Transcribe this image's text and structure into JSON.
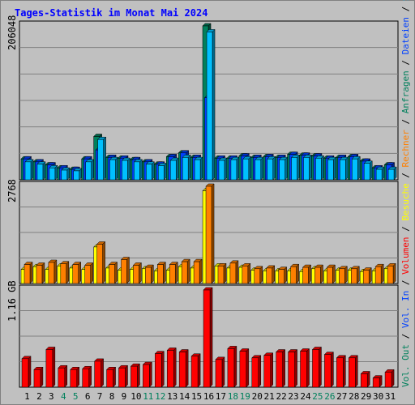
{
  "title": {
    "text": "Tages-Statistik im Monat Mai 2024",
    "color": "#0000ff"
  },
  "colors": {
    "hits": "#00805c",
    "files": "#0040ff",
    "pages": "#00c0ff",
    "visits": "#ffff00",
    "sites": "#ff8000",
    "kbytes": "#ff0000",
    "kbytes_in": "#0040ff",
    "kbytes_out": "#00805c",
    "plot_bg": "#c0c0c0",
    "grid": "#808080",
    "weekend_day": "#00805c",
    "weekday": "#000000"
  },
  "panels": {
    "top": {
      "ymax_label": "206048"
    },
    "middle": {
      "ymax_label": "2768"
    },
    "bottom": {
      "ymax_label": "1.16 GB"
    }
  },
  "legend": {
    "top": [
      {
        "text": "Anfragen",
        "color": "#00805c"
      },
      {
        "text": "Dateien",
        "color": "#0040ff"
      },
      {
        "text": "Seiten",
        "color": "#00c0ff"
      }
    ],
    "middle": [
      {
        "text": "Besuche",
        "color": "#ffff00"
      },
      {
        "text": "Rechner",
        "color": "#ff8000"
      }
    ],
    "bottom": [
      {
        "text": "Vol. Out",
        "color": "#00805c"
      },
      {
        "text": "Vol. In",
        "color": "#0040ff"
      },
      {
        "text": "Volumen",
        "color": "#ff0000"
      }
    ],
    "separator": " / "
  },
  "chart_data": {
    "type": "bar",
    "days": [
      "1",
      "2",
      "3",
      "4",
      "5",
      "6",
      "7",
      "8",
      "9",
      "10",
      "11",
      "12",
      "13",
      "14",
      "15",
      "16",
      "17",
      "18",
      "19",
      "20",
      "21",
      "22",
      "23",
      "24",
      "25",
      "26",
      "27",
      "28",
      "29",
      "30",
      "31"
    ],
    "weekend_days": [
      4,
      5,
      11,
      12,
      18,
      19,
      25,
      26
    ],
    "top": {
      "ymax": 206048,
      "series": [
        {
          "name": "Anfragen",
          "values": [
            28000,
            24000,
            20000,
            16000,
            14000,
            28000,
            58000,
            30000,
            29000,
            27000,
            24000,
            21000,
            31000,
            36000,
            30000,
            206048,
            29000,
            29000,
            32000,
            30000,
            31000,
            30000,
            34000,
            33000,
            32000,
            29000,
            30000,
            31000,
            25000,
            16000,
            20000
          ]
        },
        {
          "name": "Dateien",
          "values": [
            28000,
            24000,
            20000,
            16000,
            14000,
            28000,
            40000,
            30000,
            29000,
            27000,
            24000,
            21000,
            31000,
            36000,
            30000,
            110000,
            29000,
            29000,
            32000,
            30000,
            31000,
            30000,
            34000,
            33000,
            32000,
            29000,
            30000,
            31000,
            25000,
            16000,
            20000
          ]
        },
        {
          "name": "Seiten",
          "values": [
            24000,
            21000,
            16000,
            13000,
            12000,
            24000,
            54000,
            27000,
            26000,
            24000,
            21000,
            19000,
            26000,
            30000,
            27000,
            198000,
            26000,
            27000,
            28000,
            27000,
            28000,
            27000,
            30000,
            30000,
            29000,
            27000,
            27000,
            28000,
            22000,
            14000,
            14000
          ]
        }
      ]
    },
    "middle": {
      "ymax": 2768,
      "series": [
        {
          "name": "Besuche",
          "values": [
            400,
            480,
            400,
            500,
            440,
            400,
            1040,
            440,
            380,
            400,
            420,
            360,
            380,
            480,
            440,
            2640,
            500,
            440,
            460,
            380,
            360,
            360,
            360,
            340,
            420,
            360,
            380,
            380,
            340,
            360,
            420
          ]
        },
        {
          "name": "Rechner",
          "values": [
            540,
            520,
            600,
            560,
            540,
            520,
            1120,
            540,
            680,
            520,
            460,
            540,
            540,
            620,
            620,
            2768,
            500,
            580,
            500,
            420,
            440,
            400,
            480,
            460,
            460,
            460,
            420,
            420,
            380,
            480,
            500
          ]
        }
      ]
    },
    "bottom": {
      "ymax": 1.16,
      "unit": "GB",
      "series": [
        {
          "name": "Volumen",
          "values": [
            0.34,
            0.21,
            0.45,
            0.23,
            0.21,
            0.22,
            0.31,
            0.21,
            0.23,
            0.25,
            0.27,
            0.4,
            0.44,
            0.42,
            0.37,
            1.16,
            0.33,
            0.46,
            0.43,
            0.35,
            0.38,
            0.42,
            0.42,
            0.43,
            0.45,
            0.39,
            0.35,
            0.35,
            0.16,
            0.11,
            0.18
          ]
        }
      ]
    }
  }
}
